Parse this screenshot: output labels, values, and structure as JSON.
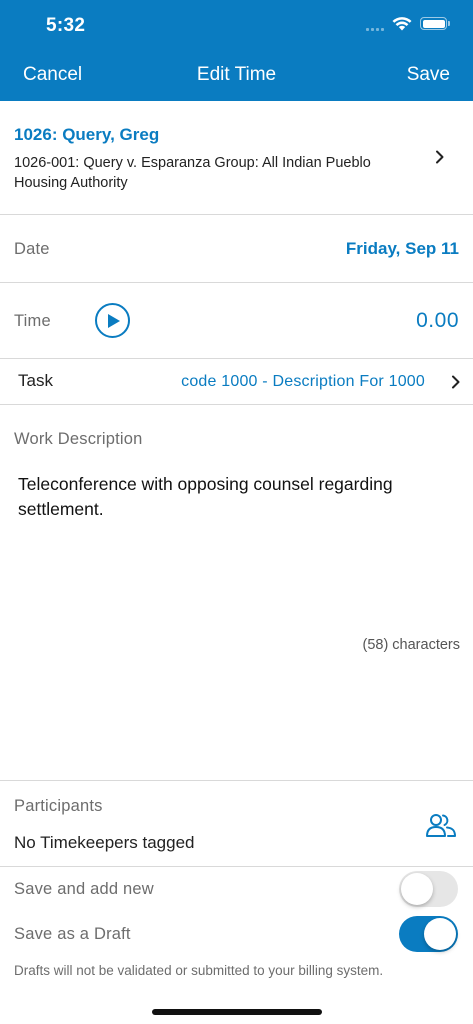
{
  "status_bar": {
    "time": "5:32"
  },
  "nav": {
    "cancel_label": "Cancel",
    "title": "Edit Time",
    "save_label": "Save"
  },
  "matter": {
    "title": "1026: Query, Greg",
    "description": "1026-001: Query v. Esparanza Group: All Indian Pueblo Housing Authority"
  },
  "date": {
    "label": "Date",
    "value": "Friday, Sep 11"
  },
  "time": {
    "label": "Time",
    "value": "0.00"
  },
  "task": {
    "label": "Task",
    "value": "code 1000 - Description For 1000"
  },
  "work_description": {
    "label": "Work Description",
    "text": "Teleconference with opposing counsel regarding settlement.",
    "char_count": "(58) characters"
  },
  "participants": {
    "label": "Participants",
    "value": "No Timekeepers tagged",
    "icon": "people-icon"
  },
  "toggles": {
    "save_and_add_new": {
      "label": "Save and add new",
      "on": false
    },
    "save_as_draft": {
      "label": "Save as a Draft",
      "on": true
    }
  },
  "footnote": "Drafts will not be validated or submitted to your billing system.",
  "colors": {
    "brand": "#0a7cc1",
    "divider": "#d9d9d9",
    "muted": "#6d6d6d"
  }
}
